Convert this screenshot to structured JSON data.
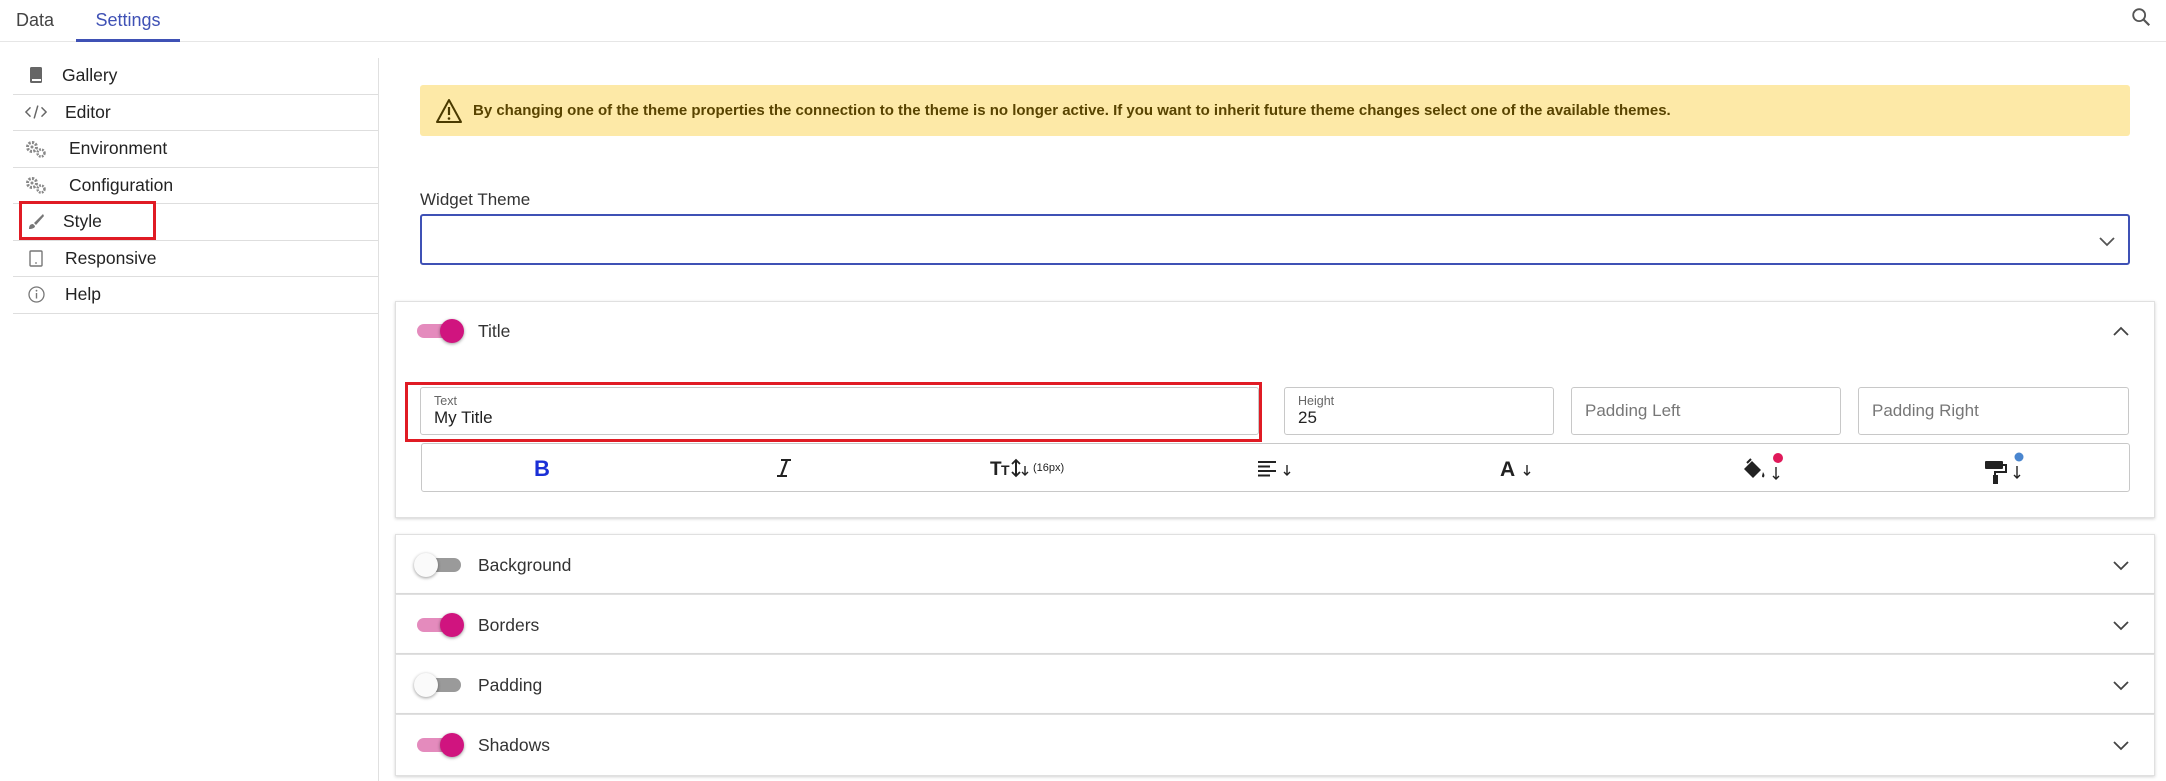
{
  "tabs": {
    "data": "Data",
    "settings": "Settings"
  },
  "sidebar": {
    "items": [
      {
        "label": "Gallery",
        "icon": "book-icon"
      },
      {
        "label": "Editor",
        "icon": "code-icon"
      },
      {
        "label": "Environment",
        "icon": "gears-icon"
      },
      {
        "label": "Configuration",
        "icon": "gears-icon"
      },
      {
        "label": "Style",
        "icon": "paintbrush-icon"
      },
      {
        "label": "Responsive",
        "icon": "tablet-icon"
      },
      {
        "label": "Help",
        "icon": "info-icon"
      }
    ]
  },
  "warning": {
    "text": "By changing one of the theme properties the connection to the theme is no longer active. If you want to inherit future theme changes select one of the available themes."
  },
  "widget_theme": {
    "label": "Widget Theme",
    "value": ""
  },
  "title_panel": {
    "label": "Title",
    "enabled": true,
    "text_field": {
      "label": "Text",
      "value": "My Title"
    },
    "height_field": {
      "label": "Height",
      "value": "25"
    },
    "padding_left": {
      "placeholder": "Padding Left"
    },
    "padding_right": {
      "placeholder": "Padding Right"
    },
    "font_size": "(16px)",
    "bold_color": "#1a2fd6",
    "fill_dot_color": "#e0195a",
    "paint_dot_color": "#4a86cf"
  },
  "panels": [
    {
      "label": "Background",
      "enabled": false
    },
    {
      "label": "Borders",
      "enabled": true
    },
    {
      "label": "Padding",
      "enabled": false
    },
    {
      "label": "Shadows",
      "enabled": true
    }
  ],
  "colors": {
    "accent": "#3f51b5",
    "toggle_on": "#d0147f",
    "highlight": "#e01b24",
    "warning_bg": "#fde9a7"
  }
}
